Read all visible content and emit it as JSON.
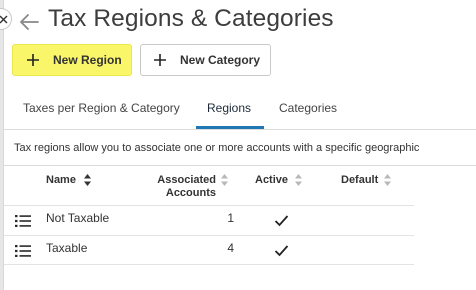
{
  "page": {
    "title": "Tax Regions & Categories"
  },
  "toolbar": {
    "new_region_label": "New Region",
    "new_category_label": "New Category",
    "new_region_bg": "#faf66a"
  },
  "tabs": [
    {
      "label": "Taxes per Region & Category",
      "active": false
    },
    {
      "label": "Regions",
      "active": true
    },
    {
      "label": "Categories",
      "active": false
    }
  ],
  "description": "Tax regions allow you to associate one or more accounts with a specific geographic",
  "table": {
    "columns": {
      "name": "Name",
      "associated_accounts_line1": "Associated",
      "associated_accounts_line2": "Accounts",
      "active": "Active",
      "default": "Default"
    },
    "rows": [
      {
        "name": "Not Taxable",
        "associated_accounts": "1",
        "active": true,
        "default": false
      },
      {
        "name": "Taxable",
        "associated_accounts": "4",
        "active": true,
        "default": false
      }
    ]
  },
  "icons": {
    "panel_close": "close-icon",
    "back": "back-arrow-icon",
    "add": "plus-icon",
    "sort": "sort-icon",
    "row_menu": "list-icon",
    "active_check": "check-icon"
  },
  "colors": {
    "accent": "#1f78b4",
    "highlight_button": "#faf66a"
  }
}
